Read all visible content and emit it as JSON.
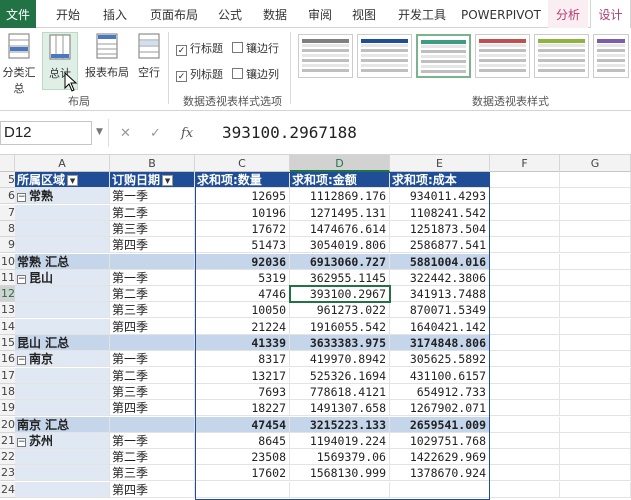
{
  "tabs": [
    "文件",
    "开始",
    "插入",
    "页面布局",
    "公式",
    "数据",
    "审阅",
    "视图",
    "开发工具",
    "POWERPIVOT",
    "分析",
    "设计"
  ],
  "ribbon": {
    "layout_buttons": [
      "分类汇总",
      "总计",
      "报表布局",
      "空行"
    ],
    "layout_group": "布局",
    "options": [
      {
        "label": "行标题",
        "checked": true
      },
      {
        "label": "镶边行",
        "checked": false
      },
      {
        "label": "列标题",
        "checked": true
      },
      {
        "label": "镶边列",
        "checked": false
      }
    ],
    "options_group": "数据透视表样式选项",
    "styles_group": "数据透视表样式",
    "style_colors": [
      "#7f7f7f",
      "#1f4e96",
      "#3c9e7e",
      "#c0504d",
      "#8eb43d",
      "#7b5ea7"
    ]
  },
  "formula_bar": {
    "name_box": "D12",
    "cancel": "✕",
    "enter": "✓",
    "fx": "fx",
    "value": "393100.2967188"
  },
  "columns": [
    "A",
    "B",
    "C",
    "D",
    "E",
    "F",
    "G"
  ],
  "row_numbers": [
    "5",
    "6",
    "7",
    "8",
    "9",
    "10",
    "11",
    "12",
    "13",
    "14",
    "15",
    "16",
    "17",
    "18",
    "19",
    "20",
    "21",
    "22",
    "23",
    "24"
  ],
  "pivot": {
    "headers": [
      "所属区域",
      "订购日期",
      "求和项:数量",
      "求和项:金额",
      "求和项:成本"
    ],
    "rows": [
      {
        "type": "detail",
        "region": "常熟",
        "quarter": "第一季",
        "qty": "12695",
        "amount": "1112869.176",
        "cost": "934011.4293"
      },
      {
        "type": "detail",
        "region": "",
        "quarter": "第二季",
        "qty": "10196",
        "amount": "1271495.131",
        "cost": "1108241.542"
      },
      {
        "type": "detail",
        "region": "",
        "quarter": "第三季",
        "qty": "17672",
        "amount": "1474676.614",
        "cost": "1251873.504"
      },
      {
        "type": "detail",
        "region": "",
        "quarter": "第四季",
        "qty": "51473",
        "amount": "3054019.806",
        "cost": "2586877.541"
      },
      {
        "type": "subtotal",
        "region": "常熟 汇总",
        "quarter": "",
        "qty": "92036",
        "amount": "6913060.727",
        "cost": "5881004.016"
      },
      {
        "type": "detail",
        "region": "昆山",
        "quarter": "第一季",
        "qty": "5319",
        "amount": "362955.1145",
        "cost": "322442.3806"
      },
      {
        "type": "detail",
        "region": "",
        "quarter": "第二季",
        "qty": "4746",
        "amount": "393100.2967",
        "cost": "341913.7488"
      },
      {
        "type": "detail",
        "region": "",
        "quarter": "第三季",
        "qty": "10050",
        "amount": "961273.022",
        "cost": "870071.5349"
      },
      {
        "type": "detail",
        "region": "",
        "quarter": "第四季",
        "qty": "21224",
        "amount": "1916055.542",
        "cost": "1640421.142"
      },
      {
        "type": "subtotal",
        "region": "昆山 汇总",
        "quarter": "",
        "qty": "41339",
        "amount": "3633383.975",
        "cost": "3174848.806"
      },
      {
        "type": "detail",
        "region": "南京",
        "quarter": "第一季",
        "qty": "8317",
        "amount": "419970.8942",
        "cost": "305625.5892"
      },
      {
        "type": "detail",
        "region": "",
        "quarter": "第二季",
        "qty": "13217",
        "amount": "525326.1694",
        "cost": "431100.6157"
      },
      {
        "type": "detail",
        "region": "",
        "quarter": "第三季",
        "qty": "7693",
        "amount": "778618.4121",
        "cost": "654912.733"
      },
      {
        "type": "detail",
        "region": "",
        "quarter": "第四季",
        "qty": "18227",
        "amount": "1491307.658",
        "cost": "1267902.071"
      },
      {
        "type": "subtotal",
        "region": "南京 汇总",
        "quarter": "",
        "qty": "47454",
        "amount": "3215223.133",
        "cost": "2659541.009"
      },
      {
        "type": "detail",
        "region": "苏州",
        "quarter": "第一季",
        "qty": "8645",
        "amount": "1194019.224",
        "cost": "1029751.768"
      },
      {
        "type": "detail",
        "region": "",
        "quarter": "第二季",
        "qty": "23508",
        "amount": "1569379.06",
        "cost": "1422629.969"
      },
      {
        "type": "detail",
        "region": "",
        "quarter": "第三季",
        "qty": "17602",
        "amount": "1568130.999",
        "cost": "1378670.924"
      },
      {
        "type": "detail",
        "region": "",
        "quarter": "第四季",
        "qty": "",
        "amount": "",
        "cost": ""
      }
    ]
  }
}
